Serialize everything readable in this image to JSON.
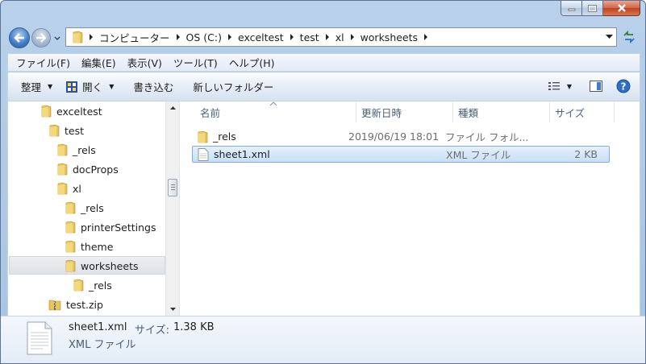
{
  "address": {
    "segments": [
      "コンピューター",
      "OS (C:)",
      "exceltest",
      "test",
      "xl",
      "worksheets"
    ]
  },
  "menu": [
    "ファイル(F)",
    "編集(E)",
    "表示(V)",
    "ツール(T)",
    "ヘルプ(H)"
  ],
  "commands": {
    "organize": "整理",
    "open": "開く",
    "burn": "書き込む",
    "new_folder": "新しいフォルダー"
  },
  "tree": [
    {
      "label": "exceltest",
      "depth": 0,
      "icon": "folder-icon"
    },
    {
      "label": "test",
      "depth": 1,
      "icon": "folder-icon"
    },
    {
      "label": "_rels",
      "depth": 2,
      "icon": "folder-icon"
    },
    {
      "label": "docProps",
      "depth": 2,
      "icon": "folder-icon"
    },
    {
      "label": "xl",
      "depth": 2,
      "icon": "folder-icon"
    },
    {
      "label": "_rels",
      "depth": 3,
      "icon": "folder-icon"
    },
    {
      "label": "printerSettings",
      "depth": 3,
      "icon": "folder-icon"
    },
    {
      "label": "theme",
      "depth": 3,
      "icon": "folder-icon"
    },
    {
      "label": "worksheets",
      "depth": 3,
      "icon": "folder-icon",
      "selected": true
    },
    {
      "label": "_rels",
      "depth": 4,
      "icon": "folder-icon"
    },
    {
      "label": "test.zip",
      "depth": 1,
      "icon": "zip-folder-icon"
    }
  ],
  "columns": {
    "name": "名前",
    "modified": "更新日時",
    "type": "種類",
    "size": "サイズ"
  },
  "files": [
    {
      "name": "_rels",
      "modified": "2019/06/19 18:01",
      "type": "ファイル フォル...",
      "size": "",
      "icon": "folder-icon",
      "selected": false
    },
    {
      "name": "sheet1.xml",
      "modified": "",
      "type": "XML ファイル",
      "size": "2 KB",
      "icon": "xml-file-icon",
      "selected": true
    }
  ],
  "details": {
    "name": "sheet1.xml",
    "size_label": "サイズ:",
    "size_value": "1.38 KB",
    "type": "XML ファイル"
  },
  "colors": {
    "selection": "#c7e0f8",
    "selection_border": "#84acdd",
    "folder": "#e8c45a",
    "help": "#2f6fc0"
  }
}
